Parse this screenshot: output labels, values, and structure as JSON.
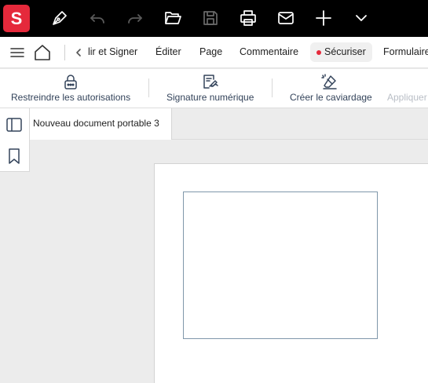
{
  "app": {
    "logo_letter": "S",
    "brand_color": "#e5293b"
  },
  "titlebar": {
    "icons": [
      "pen-icon",
      "undo-icon",
      "redo-icon",
      "open-folder-icon",
      "save-icon",
      "print-icon",
      "mail-icon",
      "plus-icon",
      "chevron-down-icon"
    ]
  },
  "menubar": {
    "items": [
      {
        "label": "lir et Signer"
      },
      {
        "label": "Éditer"
      },
      {
        "label": "Page"
      },
      {
        "label": "Commentaire"
      },
      {
        "label": "Sécuriser",
        "active": true
      },
      {
        "label": "Formulaire"
      }
    ]
  },
  "ribbon": {
    "buttons": [
      {
        "label": "Restreindre les autorisations",
        "icon": "lock-icon"
      },
      {
        "label": "Signature numérique",
        "icon": "signature-icon"
      },
      {
        "label": "Créer le caviardage",
        "icon": "redact-icon"
      },
      {
        "label": "Appliquer",
        "icon": "apply-icon",
        "disabled": true
      }
    ]
  },
  "document": {
    "tab_title": "Nouveau document portable 3"
  },
  "sidepanel": {
    "icons": [
      "panel-toggle-icon",
      "bookmark-icon"
    ]
  }
}
